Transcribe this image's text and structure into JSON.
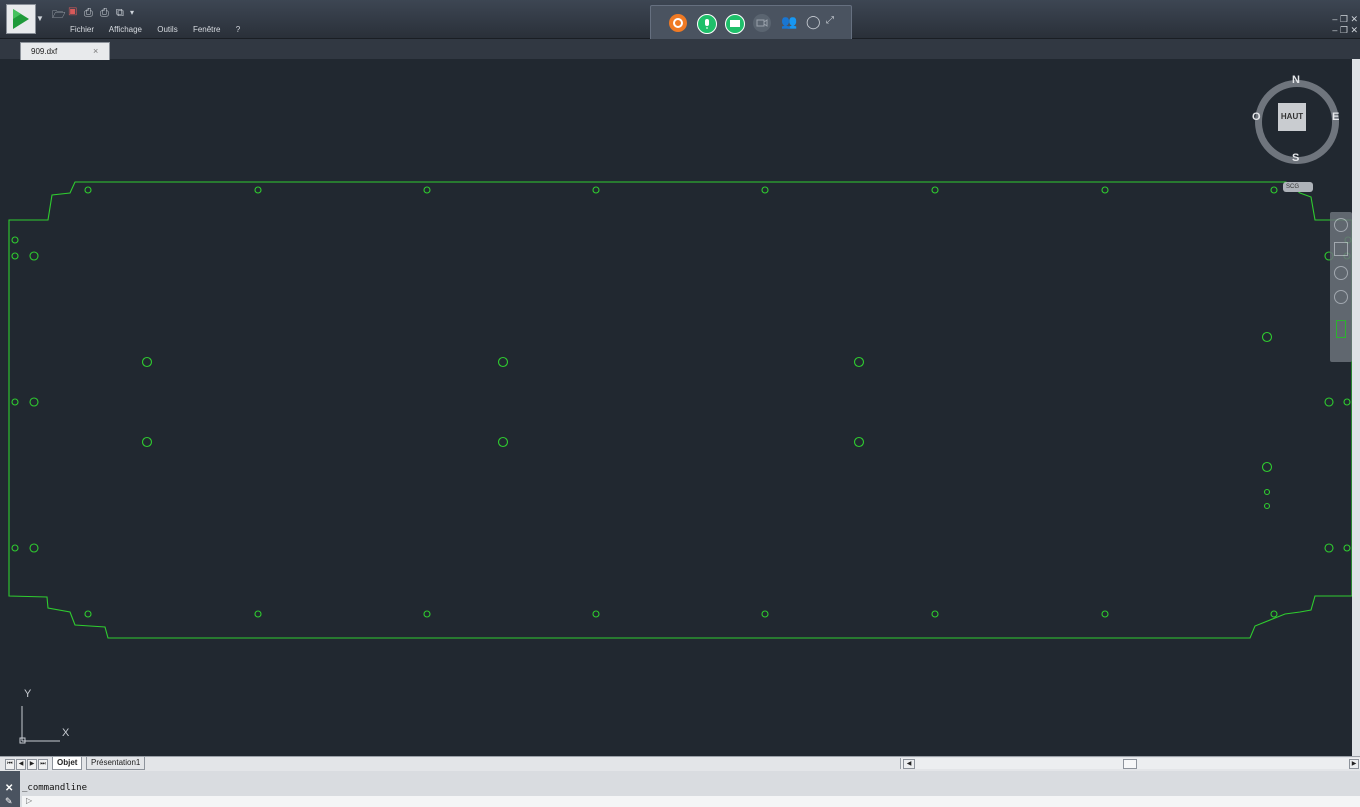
{
  "app": {
    "menu": [
      "Fichier",
      "Affichage",
      "Outils",
      "Fenêtre",
      "?"
    ],
    "colors": {
      "canvas": "#212830",
      "drawing": "#2fcc2f",
      "accent_green": "#1fbf6a",
      "orange": "#f07a24"
    }
  },
  "tabs": {
    "file_tab": "909.dxf"
  },
  "viewcube": {
    "north": "N",
    "south": "S",
    "east": "E",
    "west": "O",
    "face": "HAUT",
    "wcs": "SCG"
  },
  "ucs": {
    "y": "Y",
    "x": "X"
  },
  "layout_tabs": [
    "Objet",
    "Présentation1"
  ],
  "command": {
    "history": "_commandline",
    "prompt": "▷"
  },
  "collab_icons": [
    "settings-icon",
    "microphone-icon",
    "chat-icon",
    "camera-icon",
    "users-icon",
    "comment-icon",
    "expand-icon"
  ]
}
